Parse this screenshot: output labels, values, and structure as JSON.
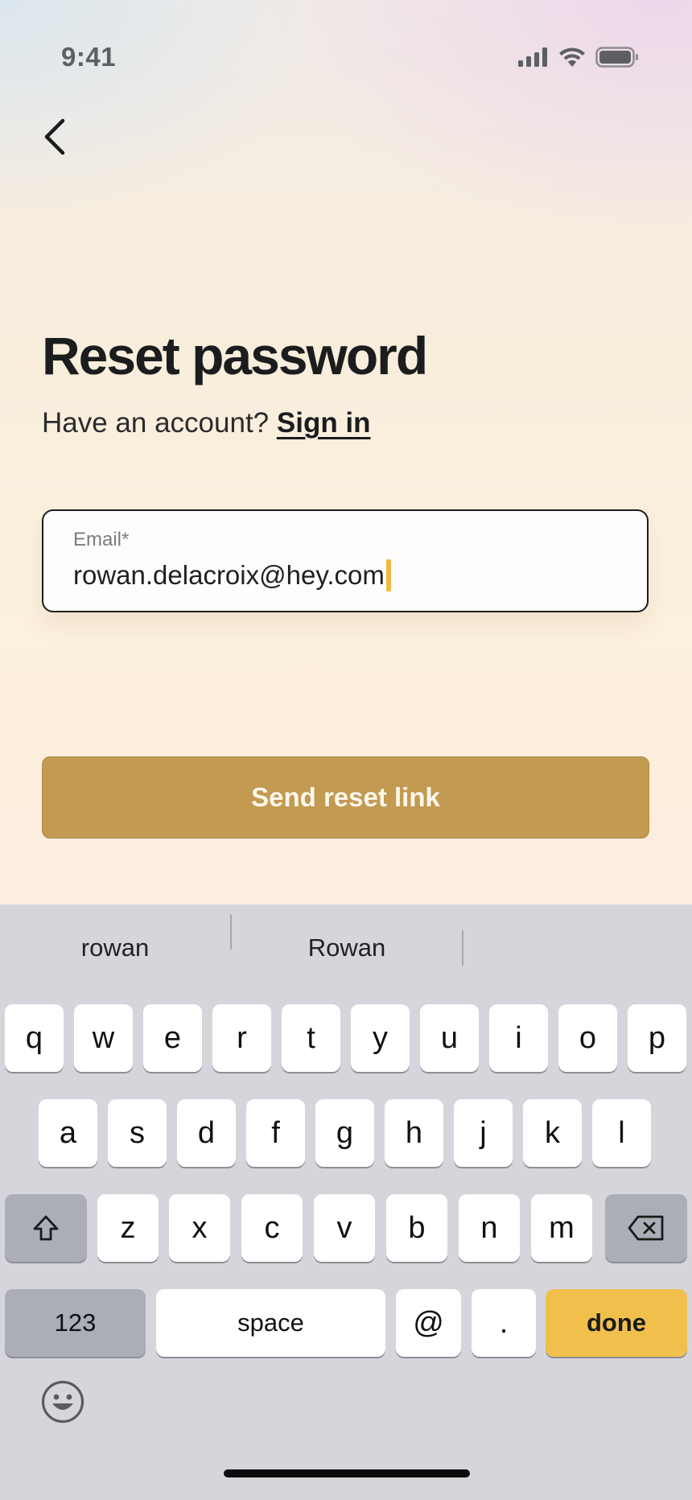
{
  "status_bar": {
    "time": "9:41"
  },
  "nav": {
    "back_icon": "chevron-left-icon"
  },
  "heading": {
    "title": "Reset password"
  },
  "subtitle": {
    "text": "Have an account?",
    "link": "Sign in"
  },
  "email_field": {
    "label": "Email*",
    "value": "rowan.delacroix@hey.com"
  },
  "primary_button": {
    "label": "Send reset link"
  },
  "colors": {
    "accent": "#c39a52",
    "caret": "#f0b940",
    "done_key": "#f0bf4c",
    "keyboard_bg": "#d6d5db"
  },
  "keyboard": {
    "suggestions": [
      "rowan",
      "Rowan",
      ""
    ],
    "row1": [
      "q",
      "w",
      "e",
      "r",
      "t",
      "y",
      "u",
      "i",
      "o",
      "p"
    ],
    "row2": [
      "a",
      "s",
      "d",
      "f",
      "g",
      "h",
      "j",
      "k",
      "l"
    ],
    "row3": [
      "z",
      "x",
      "c",
      "v",
      "b",
      "n",
      "m"
    ],
    "numbers_key": "123",
    "space_key": "space",
    "at_key": "@",
    "period_key": ".",
    "done_key": "done",
    "shift_icon": "shift-icon",
    "delete_icon": "delete-icon",
    "emoji_icon": "emoji-icon"
  }
}
